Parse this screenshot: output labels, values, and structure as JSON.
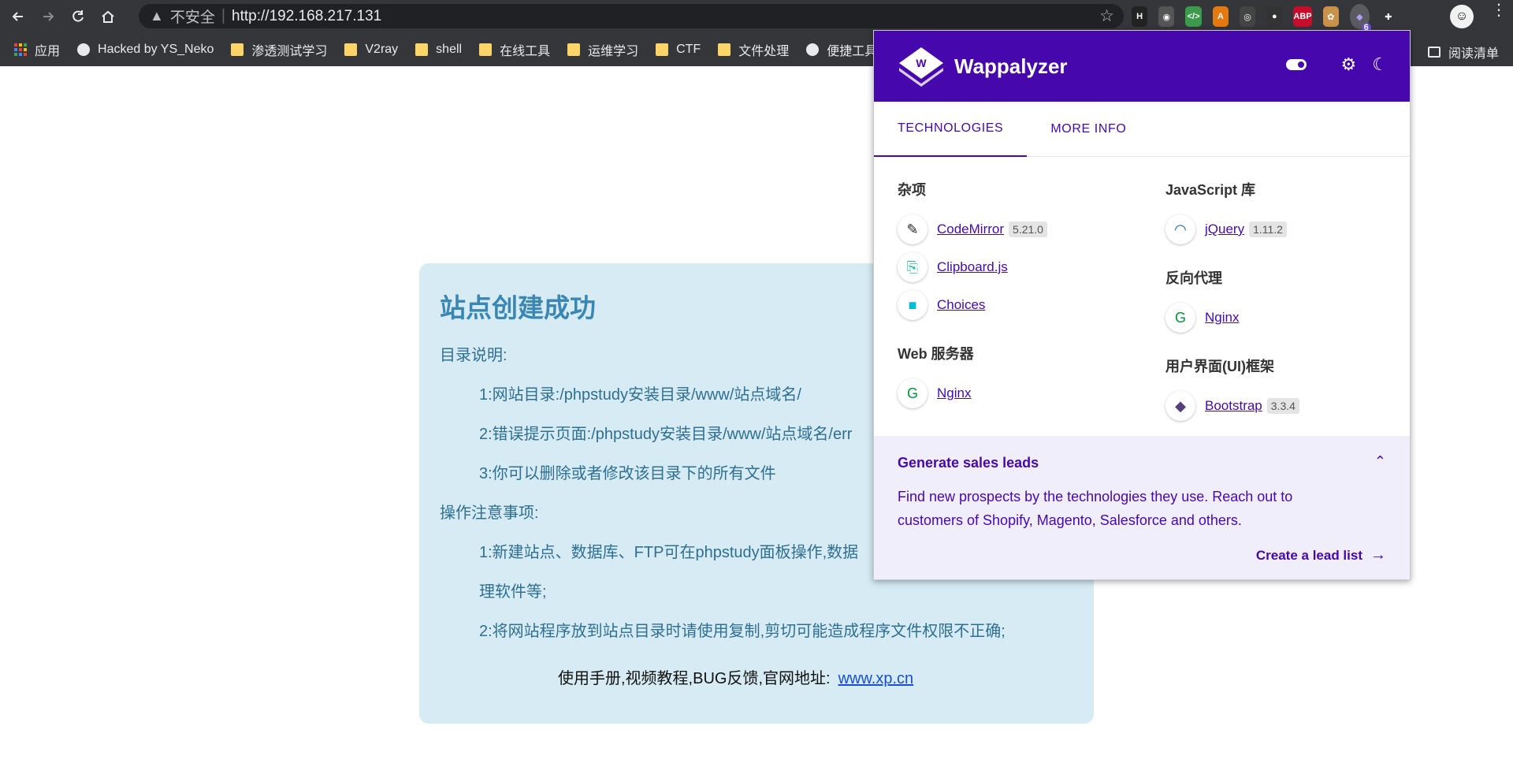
{
  "browser": {
    "security_label": "不安全",
    "url": "http://192.168.217.131",
    "extensions": [
      {
        "name": "ext-dark",
        "color": "#222222",
        "text": "H"
      },
      {
        "name": "ext-spy",
        "color": "#555555",
        "text": "◉"
      },
      {
        "name": "ext-code",
        "color": "#3c9a4c",
        "text": "</>"
      },
      {
        "name": "ext-amazon",
        "color": "#e47911",
        "text": "A"
      },
      {
        "name": "ext-glasses",
        "color": "#444444",
        "text": "◎"
      },
      {
        "name": "ext-panda",
        "color": "#333333",
        "text": "●"
      },
      {
        "name": "ext-abp",
        "color": "#c70d2c",
        "text": "ABP"
      },
      {
        "name": "ext-cookie",
        "color": "#c8924a",
        "text": "✿"
      },
      {
        "name": "ext-wappalyzer",
        "color": "#4608ad",
        "text": "◆"
      },
      {
        "name": "ext-puzzle",
        "color": "#35363a",
        "text": "✚"
      }
    ],
    "wappalyzer_badge": "6"
  },
  "bookmarks": {
    "apps": "应用",
    "items": [
      {
        "label": "Hacked by YS_Neko",
        "type": "globe"
      },
      {
        "label": "渗透测试学习",
        "type": "folder"
      },
      {
        "label": "V2ray",
        "type": "folder"
      },
      {
        "label": "shell",
        "type": "folder"
      },
      {
        "label": "在线工具",
        "type": "folder"
      },
      {
        "label": "运维学习",
        "type": "folder"
      },
      {
        "label": "CTF",
        "type": "folder"
      },
      {
        "label": "文件处理",
        "type": "folder"
      },
      {
        "label": "便捷工具",
        "type": "globe"
      }
    ],
    "reading_list": "阅读清单"
  },
  "page": {
    "title": "站点创建成功",
    "dir_heading": "目录说明:",
    "dir_1": "1:网站目录:/phpstudy安装目录/www/站点域名/",
    "dir_2": "2:错误提示页面:/phpstudy安装目录/www/站点域名/err",
    "dir_3": "3:你可以删除或者修改该目录下的所有文件",
    "ops_heading": "操作注意事项:",
    "ops_1a": "1:新建站点、数据库、FTP可在phpstudy面板操作,数据",
    "ops_1b": "理软件等;",
    "ops_2": "2:将网站程序放到站点目录时请使用复制,剪切可能造成程序文件权限不正确;",
    "footer_text": "使用手册,视频教程,BUG反馈,官网地址:",
    "footer_link": "www.xp.cn"
  },
  "wappalyzer": {
    "brand": "Wappalyzer",
    "tabs": [
      "TECHNOLOGIES",
      "MORE INFO"
    ],
    "left": [
      {
        "category": "杂项",
        "techs": [
          {
            "name": "CodeMirror",
            "version": "5.21.0",
            "icon": "codemirror-icon",
            "glyph": "✎",
            "color": "#222222"
          },
          {
            "name": "Clipboard.js",
            "version": "",
            "icon": "clipboardjs-icon",
            "glyph": "⎘",
            "color": "#29b9a0"
          },
          {
            "name": "Choices",
            "version": "",
            "icon": "choices-icon",
            "glyph": "■",
            "color": "#00bcd4"
          }
        ]
      },
      {
        "category": "Web 服务器",
        "techs": [
          {
            "name": "Nginx",
            "version": "",
            "icon": "nginx-icon",
            "glyph": "G",
            "color": "#009639"
          }
        ]
      }
    ],
    "right": [
      {
        "category": "JavaScript 库",
        "techs": [
          {
            "name": "jQuery",
            "version": "1.11.2",
            "icon": "jquery-icon",
            "glyph": "◠",
            "color": "#0769ad"
          }
        ]
      },
      {
        "category": "反向代理",
        "techs": [
          {
            "name": "Nginx",
            "version": "",
            "icon": "nginx-icon",
            "glyph": "G",
            "color": "#009639"
          }
        ]
      },
      {
        "category": "用户界面(UI)框架",
        "techs": [
          {
            "name": "Bootstrap",
            "version": "3.3.4",
            "icon": "bootstrap-icon",
            "glyph": "◆",
            "color": "#563d7c"
          }
        ]
      }
    ],
    "leads": {
      "title": "Generate sales leads",
      "text": "Find new prospects by the technologies they use. Reach out to customers of Shopify, Magento, Salesforce and others.",
      "cta": "Create a lead list"
    }
  }
}
